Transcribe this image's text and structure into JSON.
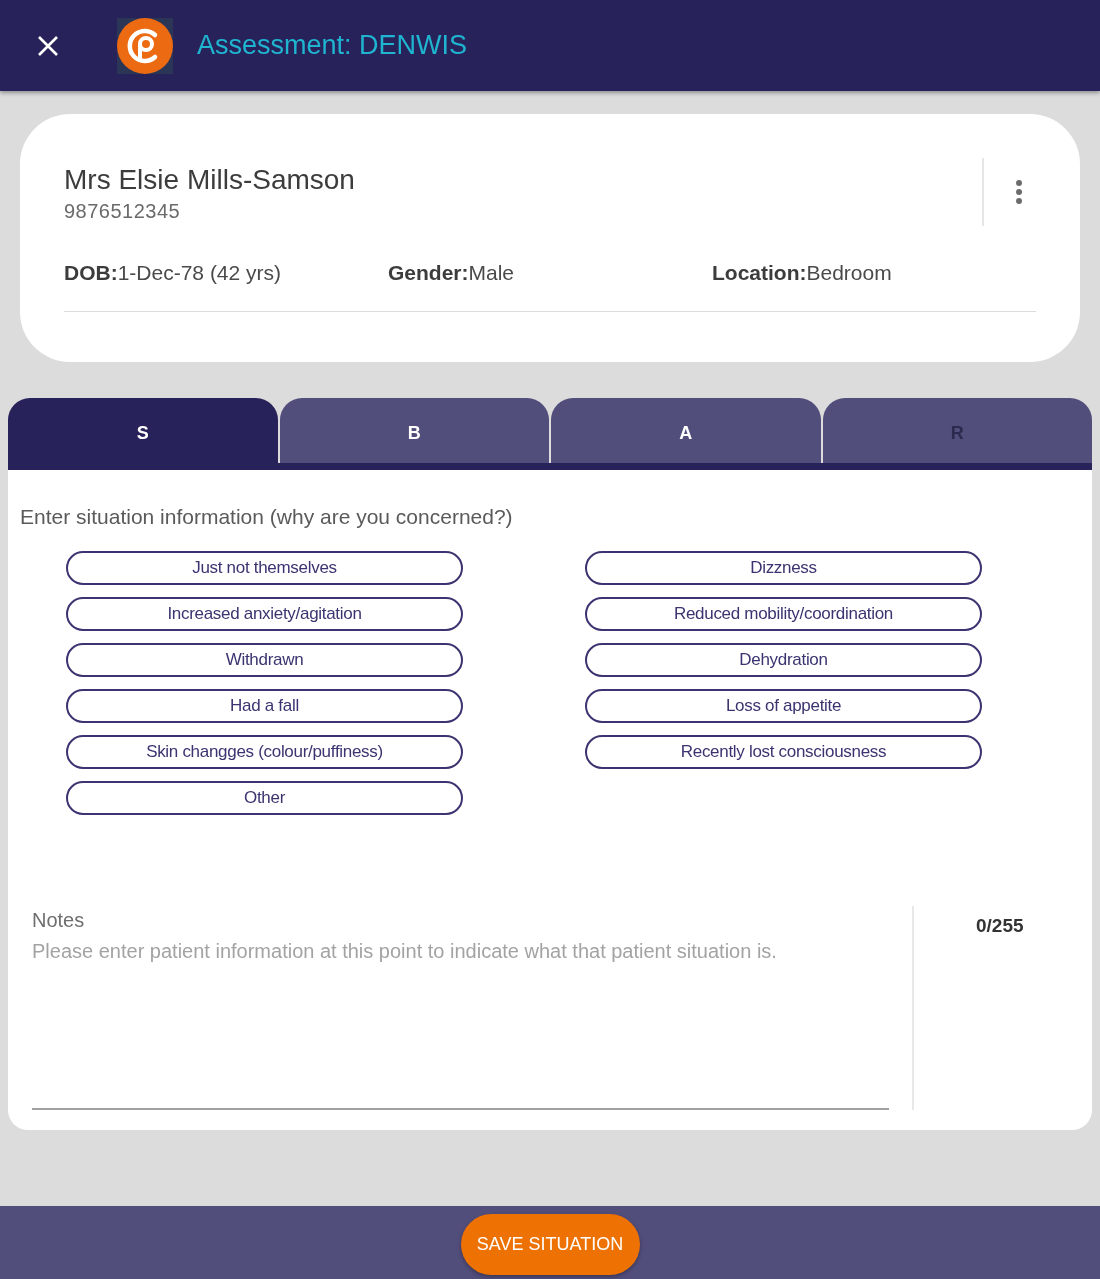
{
  "header": {
    "title": "Assessment: DENWIS"
  },
  "patient": {
    "name": "Mrs Elsie Mills-Samson",
    "id_number": "9876512345",
    "details": [
      {
        "label": "DOB:",
        "value": "1-Dec-78 (42 yrs)"
      },
      {
        "label": "Gender:",
        "value": "Male"
      },
      {
        "label": "Location:",
        "value": "Bedroom"
      }
    ]
  },
  "tabs": [
    {
      "label": "S",
      "selected": true,
      "disabled": false
    },
    {
      "label": "B",
      "selected": false,
      "disabled": false
    },
    {
      "label": "A",
      "selected": false,
      "disabled": false
    },
    {
      "label": "R",
      "selected": false,
      "disabled": true
    }
  ],
  "prompt": "Enter situation information (why are you concerned?)",
  "option_columns": [
    {
      "options": [
        {
          "label": "Just not themselves",
          "selected": false
        },
        {
          "label": "Increased anxiety/agitation",
          "selected": false
        },
        {
          "label": "Withdrawn",
          "selected": false
        },
        {
          "label": "Had a fall",
          "selected": false
        },
        {
          "label": "Skin changges (colour/puffiness)",
          "selected": false
        },
        {
          "label": "Other",
          "selected": false
        }
      ]
    },
    {
      "options": [
        {
          "label": "Dizzness",
          "selected": false
        },
        {
          "label": "Reduced mobility/coordination",
          "selected": false
        },
        {
          "label": "Dehydration",
          "selected": false
        },
        {
          "label": "Loss of appetite",
          "selected": false
        },
        {
          "label": "Recently lost consciousness",
          "selected": false
        }
      ]
    }
  ],
  "notes": {
    "label": "Notes",
    "placeholder": "Please enter patient information at this point to indicate what that patient situation is.",
    "counter": "0/255"
  },
  "footer": {
    "save_button": "SAVE SITUATION"
  }
}
